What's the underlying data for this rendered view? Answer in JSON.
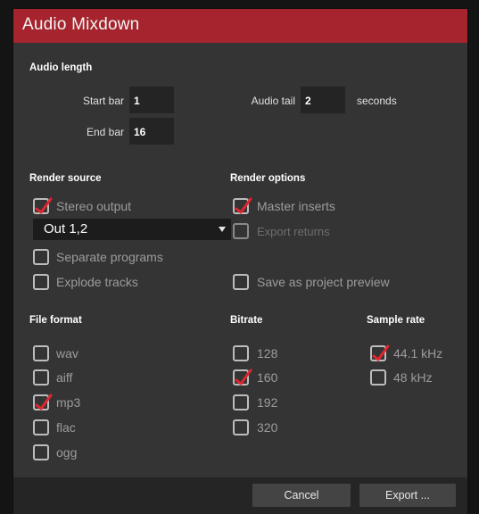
{
  "dialog": {
    "title": "Audio Mixdown"
  },
  "audio_length": {
    "heading": "Audio length",
    "start_bar_label": "Start bar",
    "start_bar_value": "1",
    "end_bar_label": "End bar",
    "end_bar_value": "16",
    "audio_tail_label": "Audio tail",
    "audio_tail_value": "2",
    "audio_tail_unit": "seconds"
  },
  "render_source": {
    "heading": "Render source",
    "stereo_output": {
      "label": "Stereo output",
      "checked": true
    },
    "output_select": {
      "value": "Out 1,2"
    },
    "separate_programs": {
      "label": "Separate programs",
      "checked": false
    },
    "explode_tracks": {
      "label": "Explode tracks",
      "checked": false
    }
  },
  "render_options": {
    "heading": "Render options",
    "master_inserts": {
      "label": "Master inserts",
      "checked": true
    },
    "export_returns": {
      "label": "Export returns",
      "checked": false,
      "disabled": true
    },
    "save_preview": {
      "label": "Save as project preview",
      "checked": false
    }
  },
  "file_format": {
    "heading": "File format",
    "options": [
      {
        "label": "wav",
        "checked": false
      },
      {
        "label": "aiff",
        "checked": false
      },
      {
        "label": "mp3",
        "checked": true
      },
      {
        "label": "flac",
        "checked": false
      },
      {
        "label": "ogg",
        "checked": false
      }
    ]
  },
  "bitrate": {
    "heading": "Bitrate",
    "options": [
      {
        "label": "128",
        "checked": false
      },
      {
        "label": "160",
        "checked": true
      },
      {
        "label": "192",
        "checked": false
      },
      {
        "label": "320",
        "checked": false
      }
    ]
  },
  "sample_rate": {
    "heading": "Sample rate",
    "options": [
      {
        "label": "44.1 kHz",
        "checked": true
      },
      {
        "label": "48 kHz",
        "checked": false
      }
    ]
  },
  "footer": {
    "cancel_label": "Cancel",
    "export_label": "Export ..."
  },
  "colors": {
    "titlebar": "#a5242d",
    "checkmark": "#e0262e",
    "panel": "#343434",
    "field": "#242424"
  },
  "icons": {
    "checkmark": "check-icon",
    "dropdown": "chevron-down-icon"
  }
}
